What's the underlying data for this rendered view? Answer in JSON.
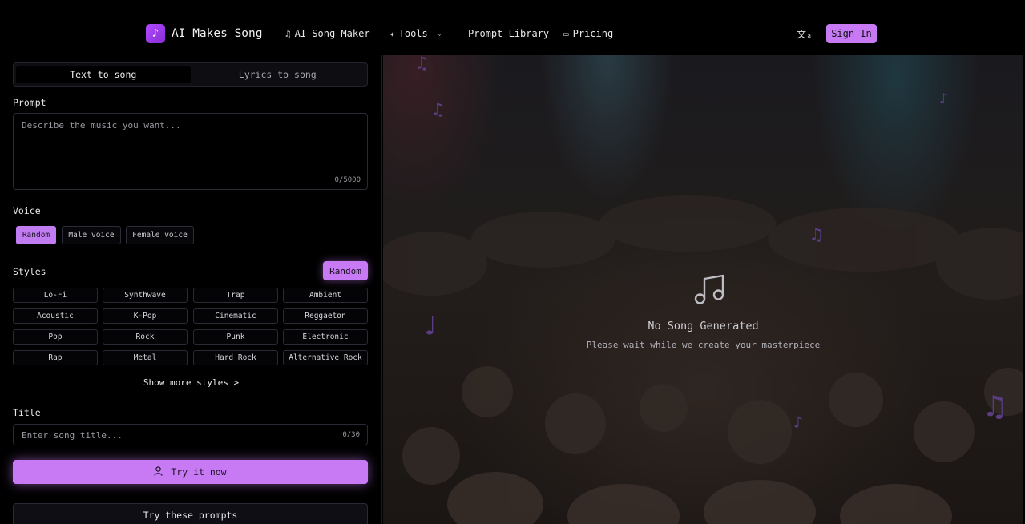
{
  "brand": {
    "name": "AI Makes Song",
    "logo_icon": "music-note-icon"
  },
  "nav": {
    "song_maker": "AI Song Maker",
    "tools": "Tools",
    "prompt_library": "Prompt Library",
    "pricing": "Pricing",
    "sign_in": "Sign In"
  },
  "tabs": [
    "Text to song",
    "Lyrics to song"
  ],
  "prompt": {
    "label": "Prompt",
    "placeholder": "Describe the music you want...",
    "counter": "0/5000"
  },
  "voice": {
    "label": "Voice",
    "options": [
      "Random",
      "Male voice",
      "Female voice"
    ],
    "selected": "Random"
  },
  "styles": {
    "label": "Styles",
    "random_label": "Random",
    "items": [
      "Lo-Fi",
      "Synthwave",
      "Trap",
      "Ambient",
      "Acoustic",
      "K-Pop",
      "Cinematic",
      "Reggaeton",
      "Pop",
      "Rock",
      "Punk",
      "Electronic",
      "Rap",
      "Metal",
      "Hard Rock",
      "Alternative Rock"
    ],
    "show_more": "Show more styles >"
  },
  "title": {
    "label": "Title",
    "placeholder": "Enter song title...",
    "counter": "0/30"
  },
  "actions": {
    "try_now": "Try it now",
    "try_prompts": "Try these prompts"
  },
  "empty_state": {
    "title": "No Song Generated",
    "subtitle": "Please wait while we create your masterpiece"
  },
  "colors": {
    "accent": "#c87af5",
    "background": "#000000"
  }
}
